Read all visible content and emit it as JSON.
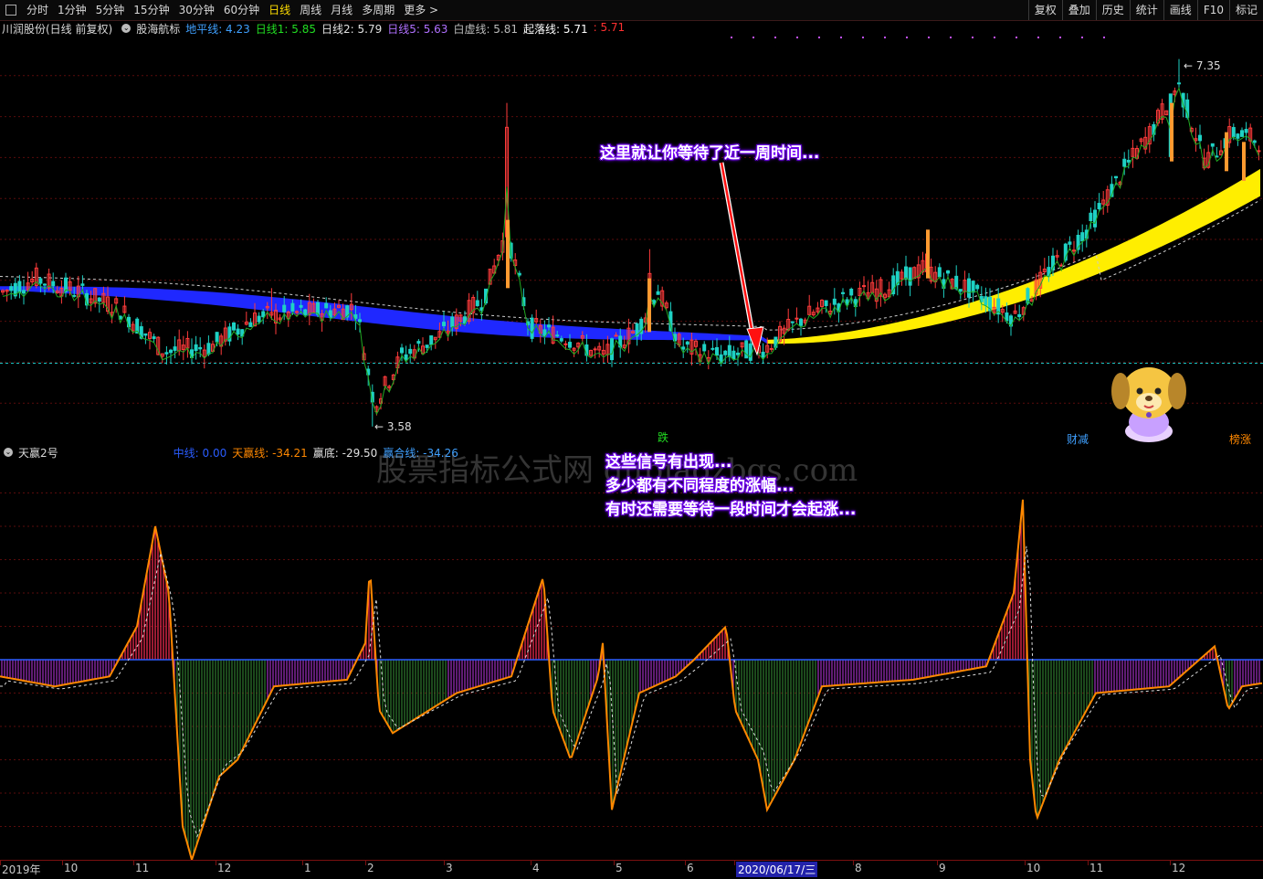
{
  "toolbar": {
    "periods": [
      "分时",
      "1分钟",
      "5分钟",
      "15分钟",
      "30分钟",
      "60分钟",
      "日线",
      "周线",
      "月线",
      "多周期",
      "更多 >"
    ],
    "active_period": "日线",
    "right_buttons": [
      "复权",
      "叠加",
      "历史",
      "统计",
      "画线",
      "F10",
      "标记"
    ]
  },
  "main_legend": {
    "stock": "川润股份(日线 前复权)",
    "indicator": "股海航标",
    "items": [
      {
        "label": "地平线: 4.23",
        "color": "#3fa0ff"
      },
      {
        "label": "日线1: 5.85",
        "color": "#22dd22"
      },
      {
        "label": "日线2: 5.79",
        "color": "#e0e0e0"
      },
      {
        "label": "日线5: 5.63",
        "color": "#b070ff"
      },
      {
        "label": "白虚线: 5.81",
        "color": "#bbbbbb"
      },
      {
        "label": "起落线: 5.71",
        "color": "#ffffff"
      },
      {
        "label": ": 5.71",
        "color": "#ff3030"
      }
    ]
  },
  "sub_legend": {
    "name": "天赢2号",
    "items": [
      {
        "label": "中线: 0.00",
        "color": "#2a5cff"
      },
      {
        "label": "天赢线: -34.21",
        "color": "#ff8800"
      },
      {
        "label": "赢底: -29.50",
        "color": "#e0e0e0"
      },
      {
        "label": "赢合线: -34.26",
        "color": "#3fa0ff"
      }
    ]
  },
  "annotations": {
    "top": "这里就让你等待了近一周时间...",
    "bottom": [
      "这些信号有出现...",
      "多少都有不同程度的涨幅...",
      "有时还需要等待一段时间才会起涨..."
    ]
  },
  "watermark": "股票指标公式网 gupiaozbgs.com",
  "price_labels": {
    "high": "7.35",
    "low": "3.58"
  },
  "tags": {
    "die": "跌",
    "caijian": "财减",
    "bangzhang": "榜涨"
  },
  "xaxis": {
    "labels": [
      "2019年",
      "10",
      "11",
      "12",
      "1",
      "2",
      "3",
      "4",
      "5",
      "6",
      "2020/06/17/三",
      "8",
      "9",
      "10",
      "11",
      "12"
    ],
    "highlight_date": "2020/06/17/三"
  },
  "colors": {
    "up": "#ff3b3b",
    "down": "#1ed1c4",
    "ma_blue": "#1f28ff",
    "ma_yellow": "#ffee00",
    "zero_line": "#2a5cff"
  },
  "chart_data": {
    "type": "candlestick",
    "title": "川润股份 日线",
    "price_range": [
      3.4,
      7.6
    ],
    "high": 7.35,
    "low": 3.58,
    "horizontal_ref": 4.23,
    "sub_indicator": {
      "name": "天赢2号",
      "range": [
        -60,
        60
      ],
      "zero": 0
    }
  }
}
